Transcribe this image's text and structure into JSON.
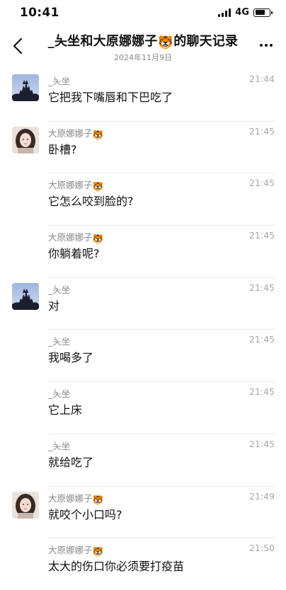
{
  "status_bar": {
    "time": "10:41",
    "network": "4G",
    "battery_level": 0.7
  },
  "header": {
    "title_prefix": "_夨坐和大原娜娜子",
    "title_suffix": "的聊天记录",
    "subtitle": "2024年11月9日",
    "emoji": "🐯",
    "back_icon": "chevron-left-icon",
    "more_icon": "more-dots-icon"
  },
  "messages": [
    {
      "sender": "_夨坐",
      "emoji": "",
      "time": "21:44",
      "text": "它把我下嘴唇和下巴吃了",
      "avatar": "cat-silhouette"
    },
    {
      "sender": "大原娜娜子",
      "emoji": "🐯",
      "time": "21:45",
      "text": "卧槽?",
      "avatar": "girl-photo"
    },
    {
      "sender": "大原娜娜子",
      "emoji": "🐯",
      "time": "21:45",
      "text": "它怎么咬到脸的?",
      "avatar": ""
    },
    {
      "sender": "大原娜娜子",
      "emoji": "🐯",
      "time": "21:45",
      "text": "你躺着呢?",
      "avatar": ""
    },
    {
      "sender": "_夨坐",
      "emoji": "",
      "time": "21:45",
      "text": "对",
      "avatar": "cat-silhouette"
    },
    {
      "sender": "_夨坐",
      "emoji": "",
      "time": "21:45",
      "text": "我喝多了",
      "avatar": ""
    },
    {
      "sender": "_夨坐",
      "emoji": "",
      "time": "21:45",
      "text": "它上床",
      "avatar": ""
    },
    {
      "sender": "_夨坐",
      "emoji": "",
      "time": "21:45",
      "text": "就给吃了",
      "avatar": ""
    },
    {
      "sender": "大原娜娜子",
      "emoji": "🐯",
      "time": "21:49",
      "text": "就咬个小口吗?",
      "avatar": "girl-photo"
    },
    {
      "sender": "大原娜娜子",
      "emoji": "🐯",
      "time": "21:50",
      "text": "太大的伤口你必须要打疫苗",
      "avatar": ""
    }
  ]
}
